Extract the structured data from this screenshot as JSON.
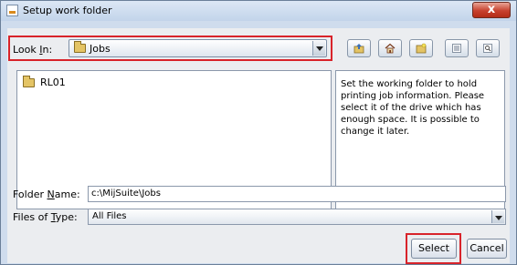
{
  "window": {
    "title": "Setup work folder",
    "close_label": "x"
  },
  "look_in": {
    "label_prefix": "Look ",
    "label_mnemonic": "I",
    "label_suffix": "n:",
    "value": "Jobs"
  },
  "toolbar": {
    "icons": [
      "up-one-level-icon",
      "home-icon",
      "new-folder-icon",
      "list-view-icon",
      "details-view-icon"
    ]
  },
  "file_list": {
    "items": [
      {
        "name": "RL01",
        "icon": "folder-icon"
      }
    ]
  },
  "info_text": "Set the working folder to hold printing job information. Please select it of the drive which has enough space. It is possible to change it later.",
  "folder_name": {
    "label_prefix": "Folder ",
    "label_mnemonic": "N",
    "label_suffix": "ame:",
    "value": "c:\\MijSuite\\Jobs"
  },
  "files_of_type": {
    "label_prefix": "Files of ",
    "label_mnemonic": "T",
    "label_suffix": "ype:",
    "value": "All Files"
  },
  "buttons": {
    "select": "Select",
    "cancel": "Cancel"
  },
  "colors": {
    "highlight": "#d8232a",
    "panel": "#ebedf0",
    "frame": "#cfdced"
  }
}
